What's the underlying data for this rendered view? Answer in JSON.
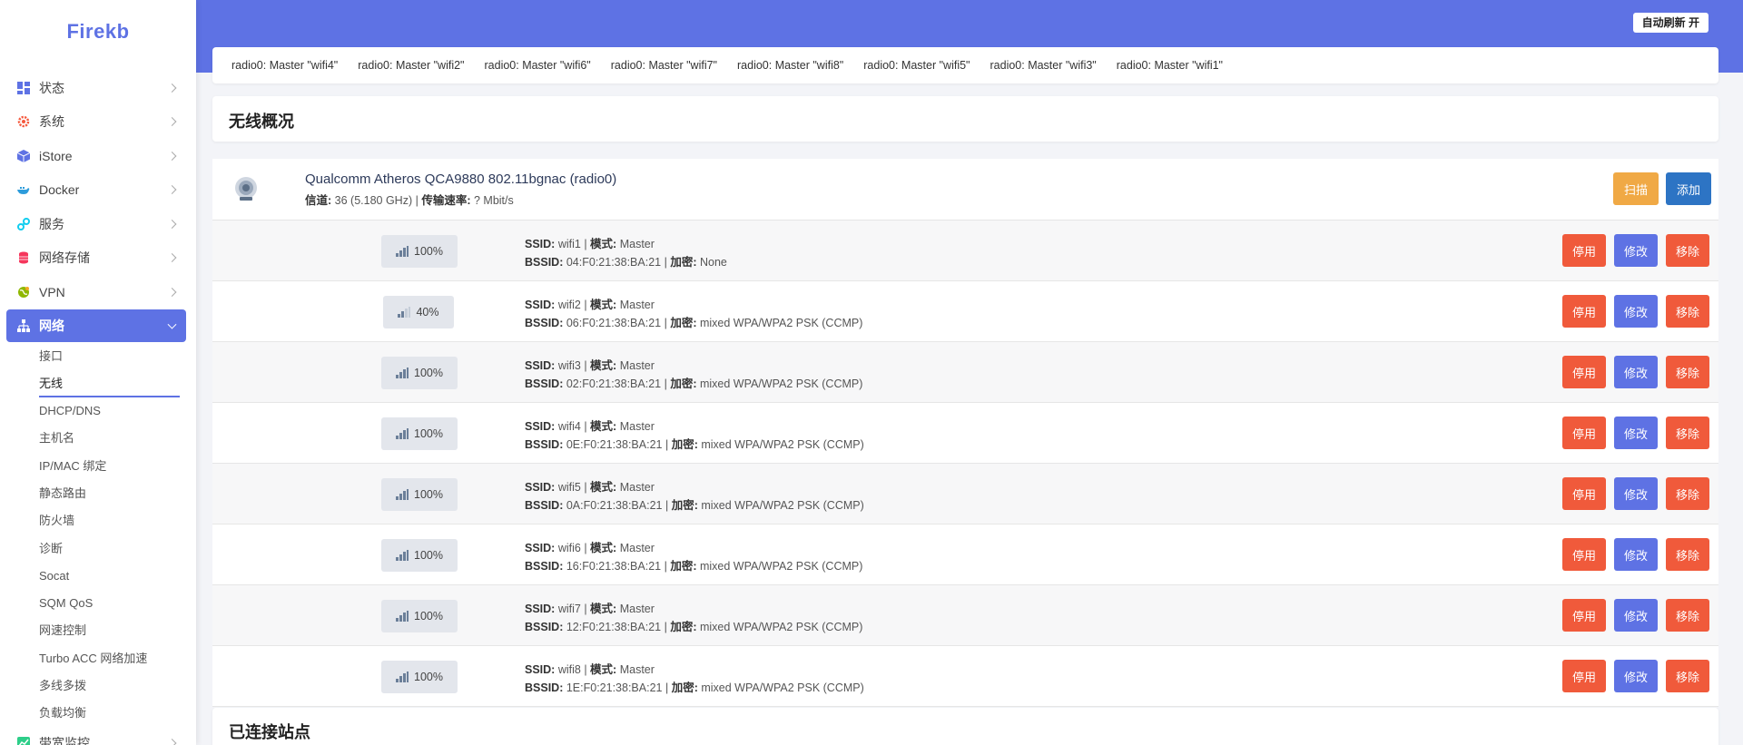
{
  "app": {
    "logo": "Firekb"
  },
  "header": {
    "auto_refresh": "自动刷新 开"
  },
  "sidebar": {
    "menu": [
      {
        "label": "状态",
        "icon": "dashboard-icon",
        "color": "#5e72e4"
      },
      {
        "label": "系统",
        "icon": "gear-icon",
        "color": "#f5593d"
      },
      {
        "label": "iStore",
        "icon": "cube-icon",
        "color": "#5e72e4"
      },
      {
        "label": "Docker",
        "icon": "whale-icon",
        "color": "#2d9cdb"
      },
      {
        "label": "服务",
        "icon": "link-icon",
        "color": "#11cdef"
      },
      {
        "label": "网络存储",
        "icon": "database-icon",
        "color": "#f5365c"
      },
      {
        "label": "VPN",
        "icon": "globe-icon",
        "color": "#8fb800"
      },
      {
        "label": "网络",
        "icon": "network-icon",
        "color": "#ffffff"
      }
    ],
    "submenu": [
      "接口",
      "无线",
      "DHCP/DNS",
      "主机名",
      "IP/MAC 绑定",
      "静态路由",
      "防火墙",
      "诊断",
      "Socat",
      "SQM QoS",
      "网速控制",
      "Turbo ACC 网络加速",
      "多线多拨",
      "负载均衡",
      "带宽监控"
    ]
  },
  "tabs": [
    "radio0: Master \"wifi4\"",
    "radio0: Master \"wifi2\"",
    "radio0: Master \"wifi6\"",
    "radio0: Master \"wifi7\"",
    "radio0: Master \"wifi8\"",
    "radio0: Master \"wifi5\"",
    "radio0: Master \"wifi3\"",
    "radio0: Master \"wifi1\""
  ],
  "overview": {
    "title": "无线概况"
  },
  "radio": {
    "name": "Qualcomm Atheros QCA9880 802.11bgnac (radio0)",
    "channel_label": "信道:",
    "channel_value": "36 (5.180 GHz)",
    "rate_label": "传输速率:",
    "rate_value": "? Mbit/s",
    "scan": "扫描",
    "add": "添加"
  },
  "labels": {
    "ssid": "SSID:",
    "mode": "模式:",
    "bssid": "BSSID:",
    "encryption": "加密:",
    "disable": "停用",
    "edit": "修改",
    "remove": "移除"
  },
  "networks": [
    {
      "signal": "100%",
      "ssid": "wifi1",
      "mode": "Master",
      "bssid": "04:F0:21:38:BA:21",
      "encryption": "None"
    },
    {
      "signal": "40%",
      "ssid": "wifi2",
      "mode": "Master",
      "bssid": "06:F0:21:38:BA:21",
      "encryption": "mixed WPA/WPA2 PSK (CCMP)"
    },
    {
      "signal": "100%",
      "ssid": "wifi3",
      "mode": "Master",
      "bssid": "02:F0:21:38:BA:21",
      "encryption": "mixed WPA/WPA2 PSK (CCMP)"
    },
    {
      "signal": "100%",
      "ssid": "wifi4",
      "mode": "Master",
      "bssid": "0E:F0:21:38:BA:21",
      "encryption": "mixed WPA/WPA2 PSK (CCMP)"
    },
    {
      "signal": "100%",
      "ssid": "wifi5",
      "mode": "Master",
      "bssid": "0A:F0:21:38:BA:21",
      "encryption": "mixed WPA/WPA2 PSK (CCMP)"
    },
    {
      "signal": "100%",
      "ssid": "wifi6",
      "mode": "Master",
      "bssid": "16:F0:21:38:BA:21",
      "encryption": "mixed WPA/WPA2 PSK (CCMP)"
    },
    {
      "signal": "100%",
      "ssid": "wifi7",
      "mode": "Master",
      "bssid": "12:F0:21:38:BA:21",
      "encryption": "mixed WPA/WPA2 PSK (CCMP)"
    },
    {
      "signal": "100%",
      "ssid": "wifi8",
      "mode": "Master",
      "bssid": "1E:F0:21:38:BA:21",
      "encryption": "mixed WPA/WPA2 PSK (CCMP)"
    }
  ],
  "connected": {
    "title": "已连接站点"
  }
}
